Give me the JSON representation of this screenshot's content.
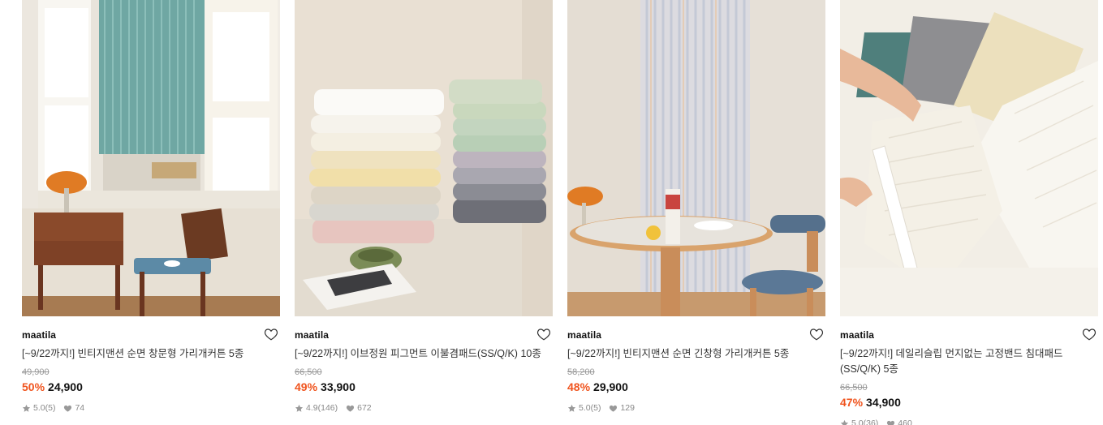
{
  "products": [
    {
      "brand": "maatila",
      "title": "[~9/22까지!] 빈티지맨션 순면 창문형 가리개커튼 5종",
      "original_price": "49,900",
      "discount": "50%",
      "price": "24,900",
      "rating": "5.0",
      "reviews": "(5)",
      "likes": "74",
      "image_icon": "window-curtain-photo"
    },
    {
      "brand": "maatila",
      "title": "[~9/22까지!] 이브정원 피그먼트 이불겸패드(SS/Q/K) 10종",
      "original_price": "66,500",
      "discount": "49%",
      "price": "33,900",
      "rating": "4.9",
      "reviews": "(146)",
      "likes": "672",
      "image_icon": "folded-quilts-photo"
    },
    {
      "brand": "maatila",
      "title": "[~9/22까지!] 빈티지맨션 순면 긴창형 가리개커튼 5종",
      "original_price": "58,200",
      "discount": "48%",
      "price": "29,900",
      "rating": "5.0",
      "reviews": "(5)",
      "likes": "129",
      "image_icon": "long-curtain-photo"
    },
    {
      "brand": "maatila",
      "title": "[~9/22까지!] 데일리슬립 먼지없는 고정밴드 침대패드(SS/Q/K) 5종",
      "original_price": "66,500",
      "discount": "47%",
      "price": "34,900",
      "rating": "5.0",
      "reviews": "(36)",
      "likes": "460",
      "image_icon": "bed-pad-photo"
    }
  ],
  "colors": {
    "discount": "#f0541e",
    "text": "#222222",
    "muted": "#999999"
  }
}
